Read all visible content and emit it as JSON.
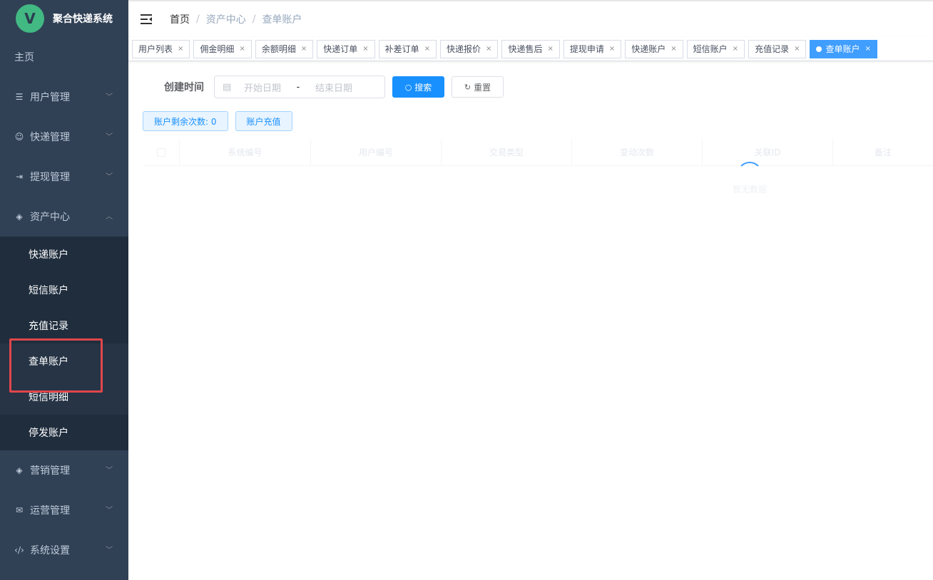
{
  "app": {
    "title": "聚合快递系统",
    "logo_letter": "V"
  },
  "sidebar": {
    "home": "主页",
    "groups": [
      {
        "label": "用户管理",
        "icon": "database-icon"
      },
      {
        "label": "快递管理",
        "icon": "chat-icon"
      },
      {
        "label": "提现管理",
        "icon": "withdraw-icon"
      },
      {
        "label": "资产中心",
        "icon": "cube-icon"
      }
    ],
    "asset_items": [
      "快递账户",
      "短信账户",
      "充值记录",
      "查单账户",
      "短信明细",
      "停发账户"
    ],
    "groups_after": [
      {
        "label": "营销管理",
        "icon": "cube-icon"
      },
      {
        "label": "运营管理",
        "icon": "mail-icon"
      },
      {
        "label": "系统设置",
        "icon": "code-icon"
      }
    ]
  },
  "breadcrumb": [
    "首页",
    "资产中心",
    "查单账户"
  ],
  "tags": [
    "用户列表",
    "佣金明细",
    "余额明细",
    "快递订单",
    "补差订单",
    "快递报价",
    "快递售后",
    "提现申请",
    "快递账户",
    "短信账户",
    "充值记录",
    "查单账户"
  ],
  "filter": {
    "label": "创建时间",
    "start_placeholder": "开始日期",
    "separator": "-",
    "end_placeholder": "结束日期",
    "search_button": "搜索",
    "reset_button": "重置"
  },
  "actions": {
    "remaining": "账户剩余次数: 0",
    "recharge": "账户充值"
  },
  "table": {
    "columns": [
      "系统编号",
      "用户编号",
      "交易类型",
      "变动次数",
      "关联ID",
      "备注"
    ],
    "empty_text": "暂无数据"
  },
  "colors": {
    "sidebar_bg": "#304156",
    "submenu_bg": "#1f2d3d",
    "primary": "#1890ff",
    "active_tag": "#409eff",
    "highlight_box": "#e0464b"
  }
}
